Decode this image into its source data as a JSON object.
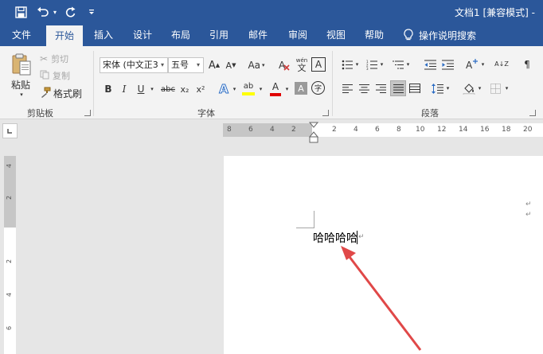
{
  "title_bar": {
    "document_title": "文档1 [兼容模式] -",
    "quick_access": [
      {
        "icon": "save-icon"
      },
      {
        "icon": "undo-icon"
      },
      {
        "icon": "redo-icon"
      },
      {
        "icon": "customize-icon"
      }
    ]
  },
  "tabs": [
    {
      "label": "文件",
      "active": false
    },
    {
      "label": "开始",
      "active": true
    },
    {
      "label": "插入",
      "active": false
    },
    {
      "label": "设计",
      "active": false
    },
    {
      "label": "布局",
      "active": false
    },
    {
      "label": "引用",
      "active": false
    },
    {
      "label": "邮件",
      "active": false
    },
    {
      "label": "审阅",
      "active": false
    },
    {
      "label": "视图",
      "active": false
    },
    {
      "label": "帮助",
      "active": false
    }
  ],
  "tell_me": {
    "label": "操作说明搜索",
    "icon": "lightbulb-icon"
  },
  "clipboard": {
    "paste_label": "粘贴",
    "cut_label": "剪切",
    "copy_label": "复制",
    "format_painter_label": "格式刷",
    "group_label": "剪贴板"
  },
  "font": {
    "font_name": "宋体 (中文正3",
    "font_size": "五号",
    "grow_label": "A",
    "shrink_label": "A",
    "case_label": "Aa",
    "phonetic_top": "wén",
    "phonetic_bottom": "文",
    "border_char": "A",
    "bold_label": "B",
    "italic_label": "I",
    "underline_label": "U",
    "strike_label": "abc",
    "subscript_label": "x₂",
    "superscript_label": "x²",
    "effects_label": "A",
    "highlight_label": "ab",
    "color_label": "A",
    "shading_label": "A",
    "enclose_label": "字",
    "group_label": "字体",
    "colors": {
      "highlight": "#ffff00",
      "font_color": "#e00000",
      "accent": "#2b579a"
    }
  },
  "paragraph": {
    "group_label": "段落",
    "sort_label": "A↓Z"
  },
  "ruler": {
    "horizontal_labels": [
      "8",
      "6",
      "4",
      "2",
      "2",
      "4",
      "6",
      "8",
      "10",
      "12",
      "14",
      "16",
      "18",
      "20"
    ],
    "vertical_labels": [
      "4",
      "2",
      "2",
      "4",
      "6"
    ]
  },
  "document": {
    "text": "哈哈哈哈",
    "paragraph_mark": "↵"
  }
}
